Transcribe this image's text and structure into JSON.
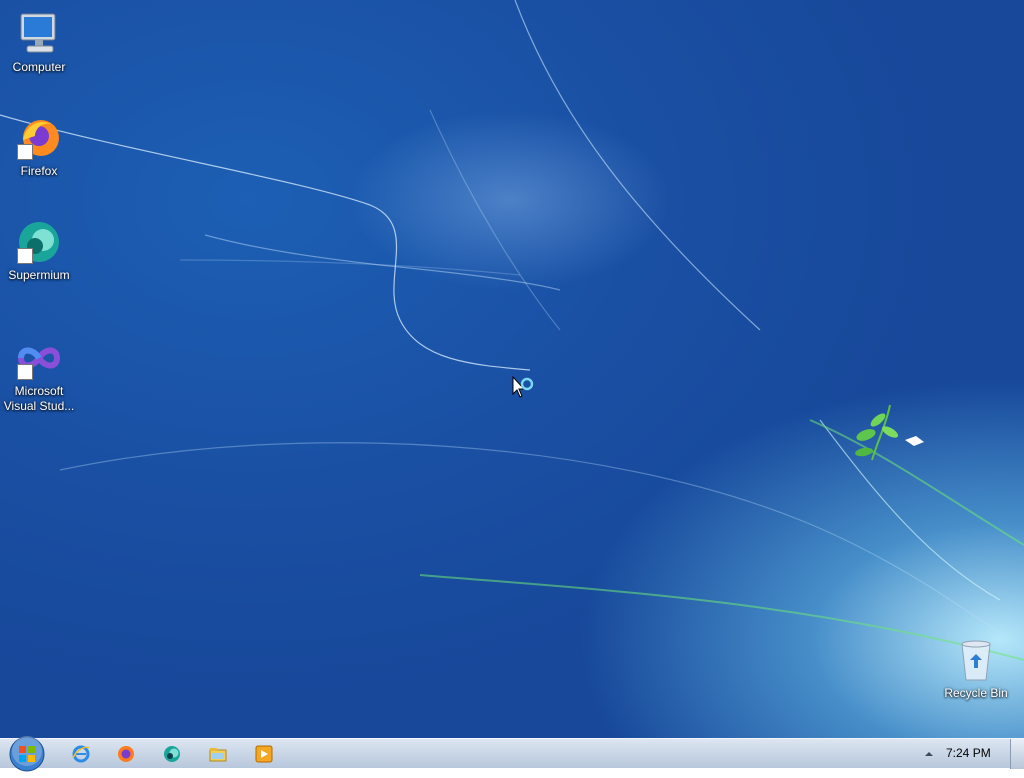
{
  "desktop": {
    "icons": [
      {
        "label": "Computer",
        "icon": "computer-icon"
      },
      {
        "label": "Firefox",
        "icon": "firefox-icon"
      },
      {
        "label": "Supermium",
        "icon": "supermium-icon"
      },
      {
        "label": "Microsoft Visual Stud...",
        "icon": "visual-studio-icon"
      },
      {
        "label": "Recycle Bin",
        "icon": "recycle-bin-icon"
      }
    ]
  },
  "taskbar": {
    "start_icon": "windows-logo-icon",
    "pinned": [
      "internet-explorer-icon",
      "firefox-icon",
      "supermium-icon",
      "file-explorer-icon",
      "media-player-icon"
    ],
    "clock": "7:24 PM"
  },
  "colors": {
    "desktop_blue": "#1a4fa3",
    "taskbar": "#c9d6e6"
  }
}
